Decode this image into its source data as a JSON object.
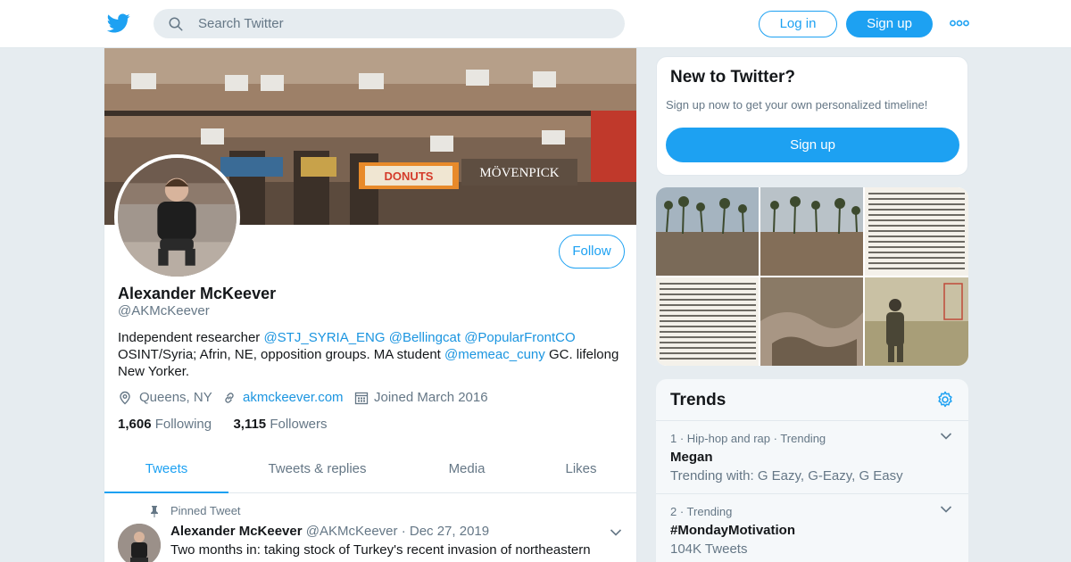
{
  "header": {
    "search_placeholder": "Search Twitter",
    "login_label": "Log in",
    "signup_label": "Sign up",
    "brand_color": "#1da1f2"
  },
  "profile": {
    "follow_label": "Follow",
    "name": "Alexander McKeever",
    "handle": "@AKMcKeever",
    "bio": {
      "t1": "Independent researcher ",
      "m1": "@STJ_SYRIA_ENG",
      "t2": " ",
      "m2": "@Bellingcat",
      "t3": " ",
      "m3": "@PopularFrontCO",
      "t4": " OSINT/Syria; Afrin, NE, opposition groups. MA student ",
      "m4": "@memeac_cuny",
      "t5": " GC. lifelong New Yorker."
    },
    "location": "Queens, NY",
    "website": "akmckeever.com",
    "joined": "Joined March 2016",
    "following_count": "1,606",
    "following_label": "Following",
    "followers_count": "3,115",
    "followers_label": "Followers"
  },
  "tabs": [
    "Tweets",
    "Tweets & replies",
    "Media",
    "Likes"
  ],
  "pinned_tweet": {
    "pinned_label": "Pinned Tweet",
    "author": "Alexander McKeever",
    "handle": "@AKMcKeever",
    "sep": "·",
    "date": "Dec 27, 2019",
    "text": "Two months in: taking stock of Turkey's recent invasion of northeastern Syria and the situation on the ground."
  },
  "new_to_twitter": {
    "title": "New to Twitter?",
    "subtitle": "Sign up now to get your own personalized timeline!",
    "signup_label": "Sign up"
  },
  "trends": {
    "title": "Trends",
    "items": [
      {
        "meta": "1 · Hip-hop and rap · Trending",
        "name": "Megan",
        "sub": "Trending with: G Eazy, G-Eazy, G Easy"
      },
      {
        "meta": "2 · Trending",
        "name": "#MondayMotivation",
        "sub": "104K Tweets"
      }
    ]
  },
  "icons": {
    "logo": "twitter-bird-icon",
    "search": "search-icon",
    "more": "more-dots-icon",
    "location": "location-pin-icon",
    "link": "link-icon",
    "calendar": "calendar-icon",
    "pin": "pin-icon",
    "chevron": "chevron-down-icon",
    "gear": "gear-icon"
  }
}
